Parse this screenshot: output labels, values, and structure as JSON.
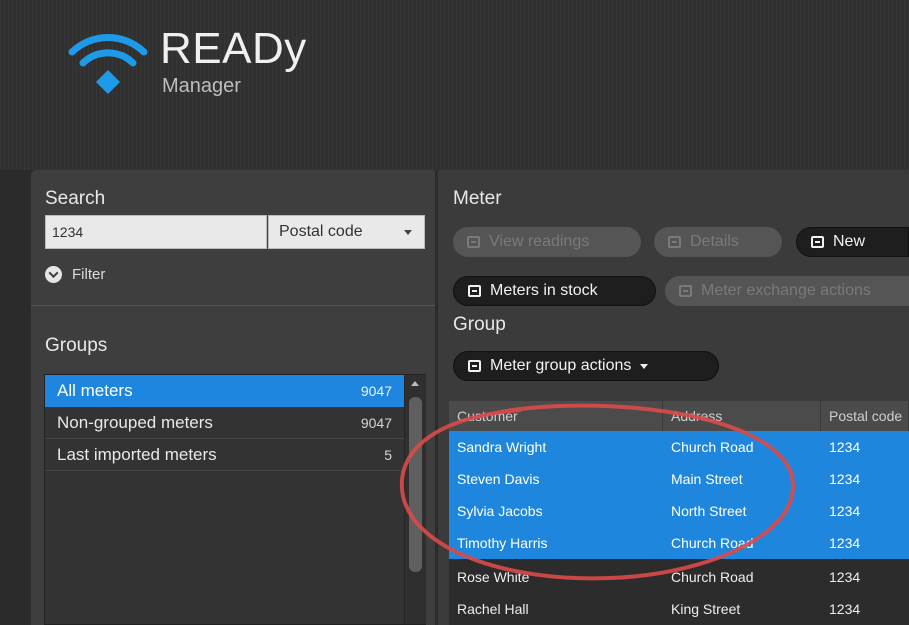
{
  "app": {
    "title": "READy",
    "subtitle": "Manager"
  },
  "colors": {
    "accent": "#1e86de",
    "annotation": "#d94a4a"
  },
  "search": {
    "heading": "Search",
    "input_value": "1234",
    "type_selected": "Postal code",
    "filter_label": "Filter"
  },
  "groups": {
    "heading": "Groups",
    "items": [
      {
        "label": "All meters",
        "count": "9047",
        "selected": true
      },
      {
        "label": "Non-grouped meters",
        "count": "9047",
        "selected": false
      },
      {
        "label": "Last imported meters",
        "count": "5",
        "selected": false
      }
    ]
  },
  "meter": {
    "heading": "Meter",
    "view_readings": "View readings",
    "details": "Details",
    "new": "New",
    "meters_in_stock": "Meters in stock",
    "meter_exchange_actions": "Meter exchange actions"
  },
  "group": {
    "heading": "Group",
    "meter_group_actions": "Meter group actions"
  },
  "table": {
    "columns": [
      "Customer",
      "Address",
      "Postal code"
    ],
    "rows": [
      {
        "customer": "Sandra Wright",
        "address": "Church Road",
        "postal": "1234",
        "selected": true
      },
      {
        "customer": "Steven Davis",
        "address": "Main Street",
        "postal": "1234",
        "selected": true
      },
      {
        "customer": "Sylvia Jacobs",
        "address": "North Street",
        "postal": "1234",
        "selected": true
      },
      {
        "customer": "Timothy Harris",
        "address": "Church Road",
        "postal": "1234",
        "selected": true
      },
      {
        "customer": "Rose White",
        "address": "Church Road",
        "postal": "1234",
        "selected": false
      },
      {
        "customer": "Rachel Hall",
        "address": "King Street",
        "postal": "1234",
        "selected": false
      }
    ]
  }
}
